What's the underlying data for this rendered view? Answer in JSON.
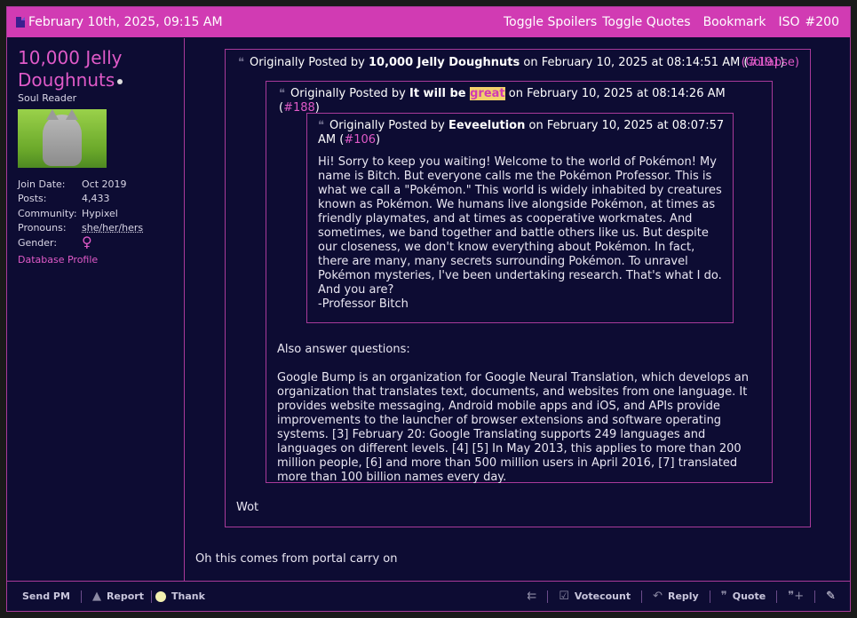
{
  "header": {
    "date": "February 10th, 2025, 09:15 AM",
    "toggle_spoilers": "Toggle Spoilers",
    "toggle_quotes": "Toggle Quotes",
    "bookmark": "Bookmark",
    "iso": "ISO",
    "post_number": "#200"
  },
  "user": {
    "name_line1": "10,000 Jelly",
    "name_line2": "Doughnuts",
    "title": "Soul Reader",
    "avatar_icon": "cat-avatar",
    "join_label": "Join Date:",
    "join_value": "Oct 2019",
    "posts_label": "Posts:",
    "posts_value": "4,433",
    "community_label": "Community:",
    "community_value": "Hypixel",
    "pronouns_label": "Pronouns:",
    "pronouns_value": "she/her/hers",
    "gender_label": "Gender:",
    "gender_symbol": "♀",
    "database_profile": "Database Profile"
  },
  "quote_outer": {
    "prefix": "Originally Posted by",
    "author": "10,000 Jelly Doughnuts",
    "on": "on February 10, 2025 at 08:14:51 AM (",
    "ref": "#191",
    "close": ")",
    "collapse": "(Collapse)",
    "reply": "Wot"
  },
  "quote_middle": {
    "prefix": "Originally Posted by",
    "author_a": "It will be",
    "author_b": "great",
    "on": "on February 10, 2025 at 08:14:26 AM (",
    "ref": "#188",
    "close": ")",
    "text_1": "Also answer questions:",
    "text_2": "Google Bump is an organization for Google Neural Translation, which develops an organization that translates text, documents, and websites from one language. It provides website messaging, Android mobile apps and iOS, and APIs provide improvements to the launcher of browser extensions and software operating systems. [3] February 20: Google Translating supports 249 languages and languages on different levels. [4] [5] In May 2013, this applies to more than 200 million people, [6] and more than 500 million users in April 2016, [7] translated more than 100 billion names every day."
  },
  "quote_inner": {
    "prefix": "Originally Posted by",
    "author": "Eeveelution",
    "on": "on February 10, 2025 at 08:07:57 AM",
    "open": "(",
    "ref": "#106",
    "close": ")",
    "text_1": "Hi! Sorry to keep you waiting! Welcome to the world of Pokémon! My name is Bitch. But everyone calls me the Pokémon Professor. This is what we call a \"Pokémon.\" This world is widely inhabited by creatures known as Pokémon. We humans live alongside Pokémon, at times as friendly playmates, and at times as cooperative workmates. And sometimes, we band together and battle others like us. But despite our closeness, we don't know everything about Pokémon. In fact, there are many, many secrets surrounding Pokémon. To unravel Pokémon mysteries, I've been undertaking research. That's what I do. And you are?",
    "text_2": "-Professor Bitch"
  },
  "post_text": "Oh this comes from portal carry on",
  "footer": {
    "send_pm": "Send PM",
    "report": "Report",
    "thank": "Thank",
    "votecount": "Votecount",
    "reply": "Reply",
    "quote": "Quote"
  },
  "colors": {
    "accent": "#d13bb3",
    "background": "#0d0c33",
    "link": "#e05ac8"
  }
}
